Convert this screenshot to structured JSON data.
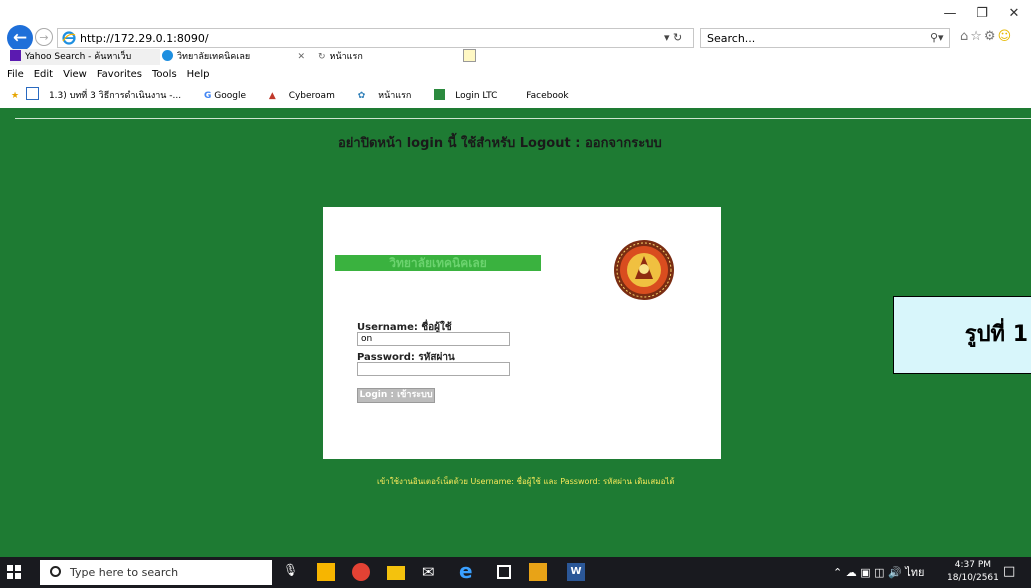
{
  "browser": {
    "address": "http://172.29.0.1:8090/",
    "search_placeholder": "Search...",
    "tabs": [
      {
        "label": "Yahoo Search - ค้นหาเว็บ"
      },
      {
        "label": "วิทยาลัยเทคนิคเลย"
      },
      {
        "label": "หน้าแรก"
      }
    ],
    "menu": [
      "File",
      "Edit",
      "View",
      "Favorites",
      "Tools",
      "Help"
    ],
    "favorites": [
      "1.3) บทที่ 3 วิธีการดำเนินงาน -...",
      "Google",
      "Cyberoam",
      "หน้าแรก",
      "Login LTC",
      "Facebook"
    ]
  },
  "page": {
    "warning": "อย่าปิดหน้า login นี้ ใช้สำหรับ Logout : ออกจากระบบ",
    "college_name": "วิทยาลัยเทคนิคเลย",
    "username_label": "Username: ชื่อผู้ใช้",
    "username_value": "on",
    "password_label": "Password: รหัสผ่าน",
    "login_button": "Login : เข้าระบบ",
    "footer": "เข้าใช้งานอินเตอร์เน็ตด้วย Username: ชื่อผู้ใช้ และ Password: รหัสผ่าน เดิมเสมอได้"
  },
  "figure_label": "รูปที่ 1",
  "taskbar": {
    "search_placeholder": "Type here to search",
    "tray_language": "ไทย",
    "time": "4:37 PM",
    "date": "18/10/2561"
  },
  "colors": {
    "page_bg": "#1e7b33",
    "banner_bg": "#3ab23f",
    "figure_label_bg": "#d8f6fb",
    "taskbar_bg": "#191a1f"
  }
}
